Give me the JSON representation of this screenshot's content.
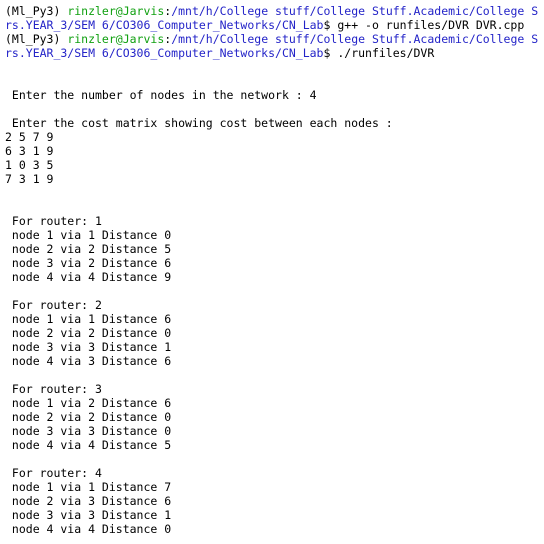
{
  "colors": {
    "background": "#ffffff",
    "text": "#000000",
    "prompt_user": "#10a010",
    "prompt_path": "#2424c8"
  },
  "session": [
    {
      "env": "(Ml_Py3) ",
      "user": "rinzler@Jarvis",
      "sep": ":",
      "path1": "/mnt/h/College stuff/College Stuff.Academic/College S",
      "path2": "rs.YEAR_3/SEM 6/CO306_Computer_Networks/CN_Lab",
      "cmd": "$ g++ -o runfiles/DVR DVR.cpp"
    },
    {
      "env": "(Ml_Py3) ",
      "user": "rinzler@Jarvis",
      "sep": ":",
      "path1": "/mnt/h/College stuff/College Stuff.Academic/College S",
      "path2": "rs.YEAR_3/SEM 6/CO306_Computer_Networks/CN_Lab",
      "cmd": "$ ./runfiles/DVR"
    }
  ],
  "output": {
    "nodes_prompt": " Enter the number of nodes in the network : 4",
    "matrix_prompt": " Enter the cost matrix showing cost between each nodes :",
    "matrix": [
      "2 5 7 9",
      "6 3 1 9",
      "1 0 3 5",
      "7 3 1 9"
    ],
    "routers": [
      {
        "header": " For router: 1",
        "rows": [
          " node 1 via 1 Distance 0",
          " node 2 via 2 Distance 5",
          " node 3 via 2 Distance 6",
          " node 4 via 4 Distance 9"
        ]
      },
      {
        "header": " For router: 2",
        "rows": [
          " node 1 via 1 Distance 6",
          " node 2 via 2 Distance 0",
          " node 3 via 3 Distance 1",
          " node 4 via 3 Distance 6"
        ]
      },
      {
        "header": " For router: 3",
        "rows": [
          " node 1 via 2 Distance 6",
          " node 2 via 2 Distance 0",
          " node 3 via 3 Distance 0",
          " node 4 via 4 Distance 5"
        ]
      },
      {
        "header": " For router: 4",
        "rows": [
          " node 1 via 1 Distance 7",
          " node 2 via 3 Distance 6",
          " node 3 via 3 Distance 1",
          " node 4 via 4 Distance 0"
        ]
      }
    ]
  }
}
